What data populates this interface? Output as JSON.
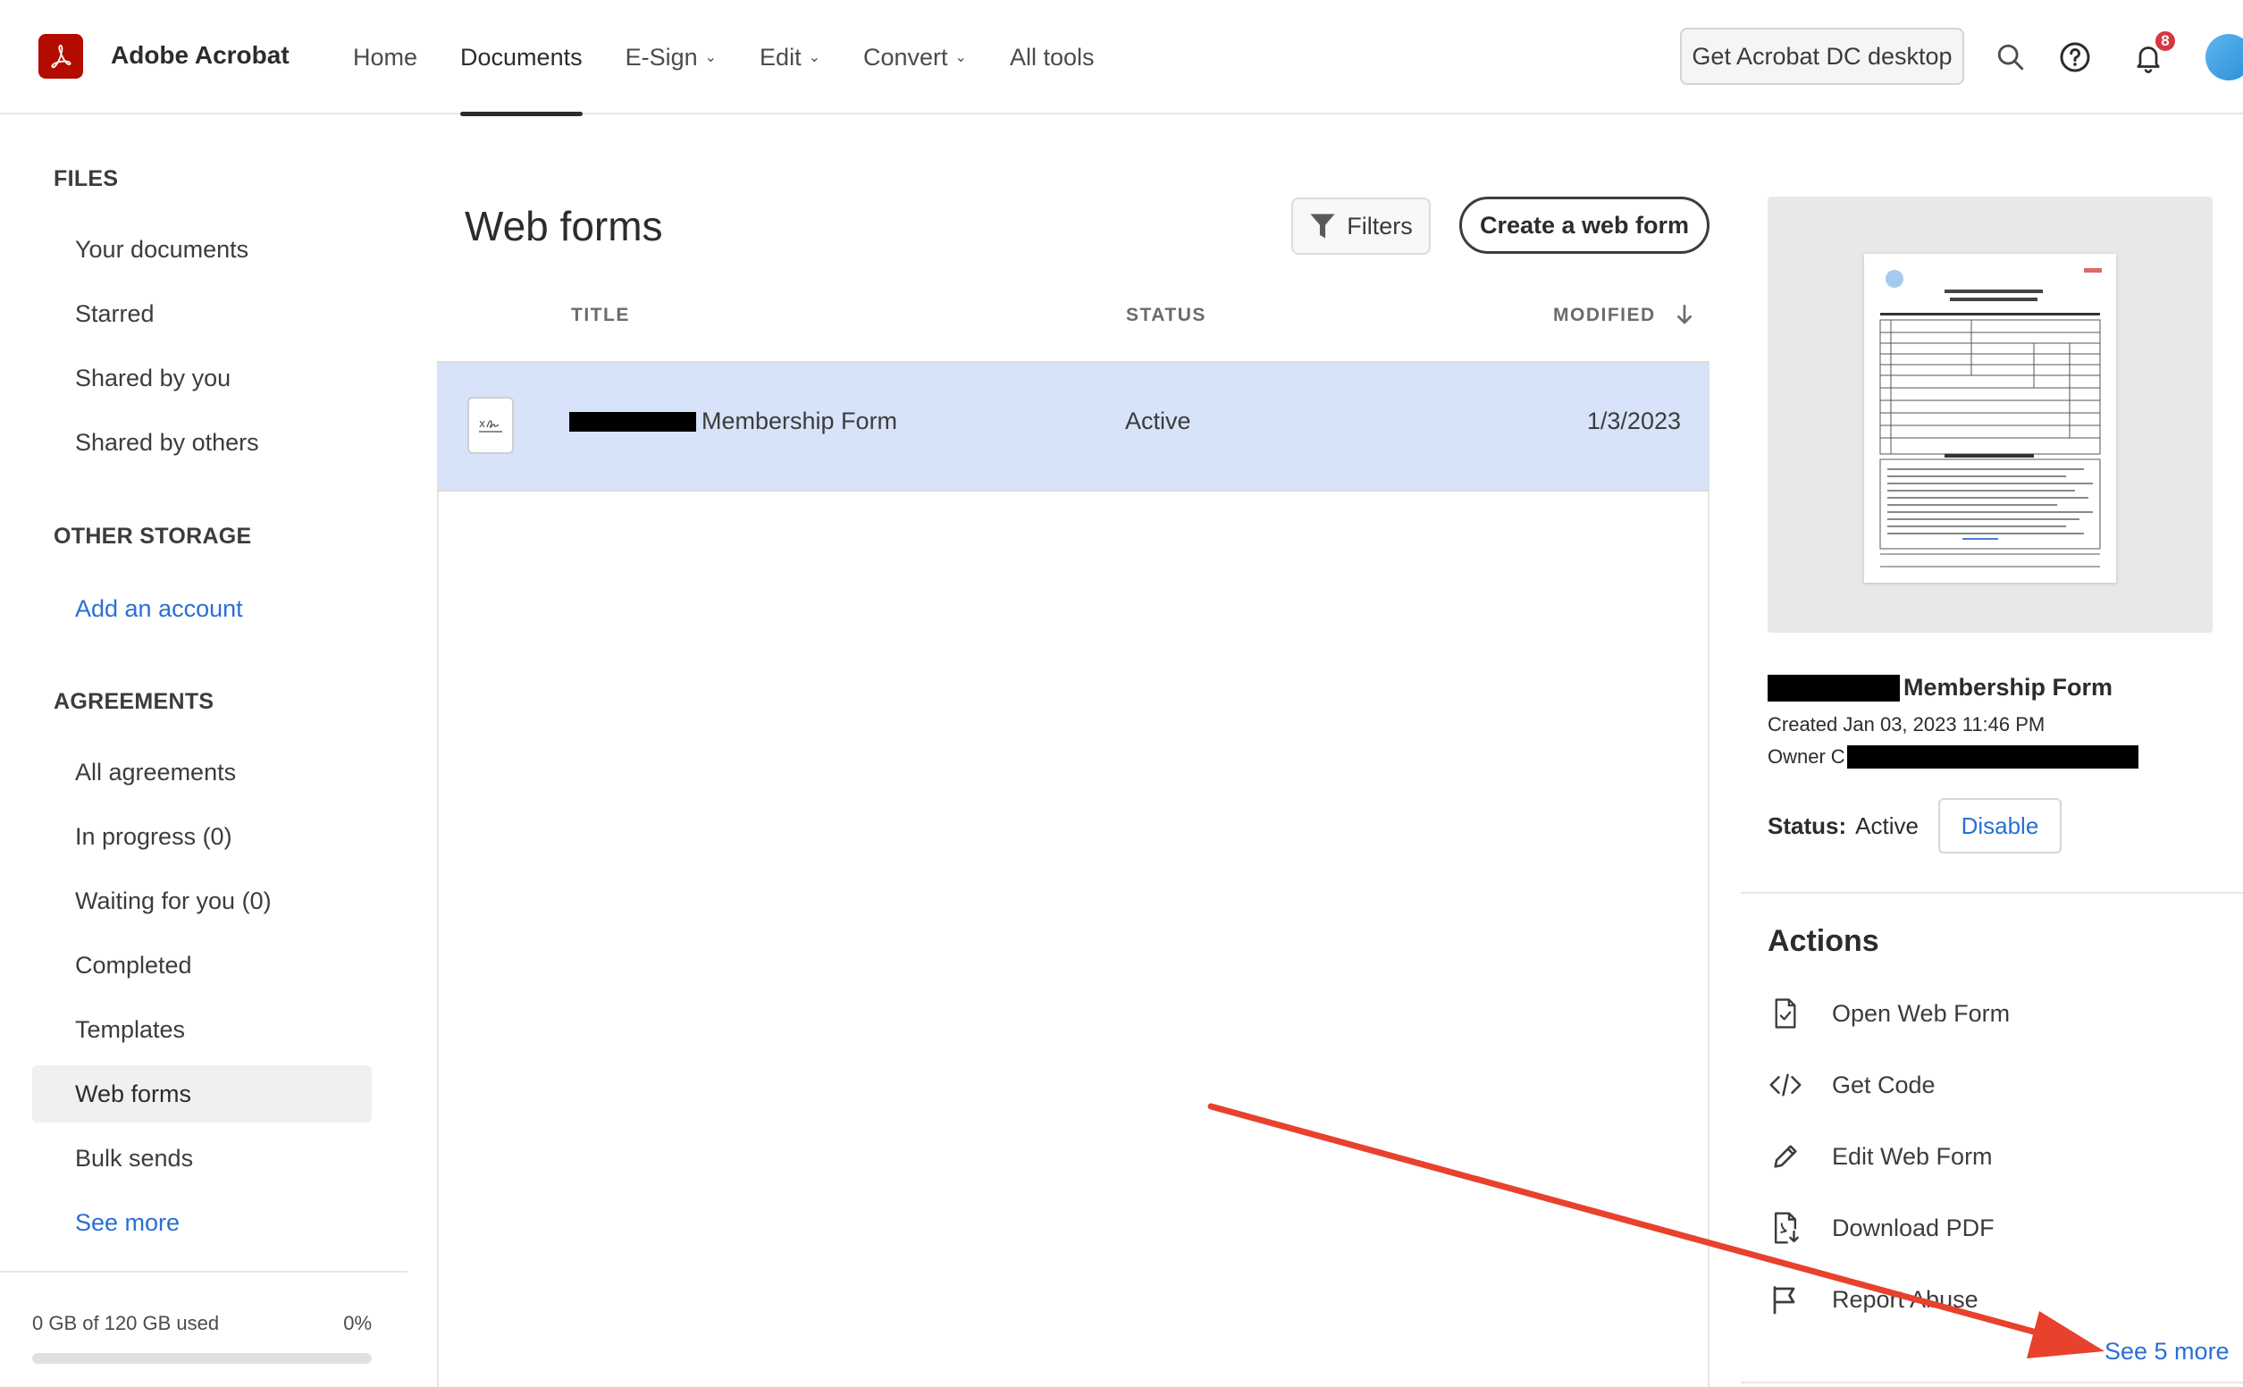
{
  "header": {
    "app_name": "Adobe Acrobat",
    "logo_icon": "acrobat-logo-icon",
    "nav": [
      {
        "label": "Home",
        "dropdown": false,
        "active": false
      },
      {
        "label": "Documents",
        "dropdown": false,
        "active": true
      },
      {
        "label": "E-Sign",
        "dropdown": true,
        "active": false
      },
      {
        "label": "Edit",
        "dropdown": true,
        "active": false
      },
      {
        "label": "Convert",
        "dropdown": true,
        "active": false
      },
      {
        "label": "All tools",
        "dropdown": false,
        "active": false
      }
    ],
    "desktop_button": "Get Acrobat DC desktop",
    "icons": [
      "search-icon",
      "help-icon",
      "notification-bell-icon",
      "avatar"
    ],
    "notification_count": "8"
  },
  "sidebar": {
    "files_title": "FILES",
    "files_items": [
      "Your documents",
      "Starred",
      "Shared by you",
      "Shared by others"
    ],
    "other_storage_title": "OTHER STORAGE",
    "add_account": "Add an account",
    "agreements_title": "AGREEMENTS",
    "agreements_items": [
      "All agreements",
      "In progress (0)",
      "Waiting for you (0)",
      "Completed",
      "Templates",
      "Web forms",
      "Bulk sends"
    ],
    "selected_item": "Web forms",
    "see_more": "See more",
    "storage": {
      "label": "0 GB of 120 GB used",
      "percent_label": "0%",
      "used_fraction": 0
    }
  },
  "main": {
    "title": "Web forms",
    "filters_label": "Filters",
    "create_label": "Create a web form",
    "columns": {
      "title": "TITLE",
      "status": "STATUS",
      "modified": "MODIFIED"
    },
    "sort_icon": "arrow-down-icon",
    "rows": [
      {
        "title_redacted": true,
        "title": "Membership Form",
        "status": "Active",
        "modified": "1/3/2023",
        "icon": "web-form-document-icon",
        "selected": true
      }
    ]
  },
  "details": {
    "title_redacted": true,
    "title": "Membership Form",
    "created": "Created Jan 03, 2023 11:46 PM",
    "owner_label": "Owner",
    "owner_redacted": true,
    "status_label": "Status:",
    "status_value": "Active",
    "disable_label": "Disable",
    "actions_title": "Actions",
    "actions": [
      {
        "label": "Open Web Form",
        "icon": "open-web-form-icon"
      },
      {
        "label": "Get Code",
        "icon": "code-icon"
      },
      {
        "label": "Edit Web Form",
        "icon": "pencil-icon"
      },
      {
        "label": "Download PDF",
        "icon": "download-pdf-icon"
      },
      {
        "label": "Report Abuse",
        "icon": "flag-icon"
      }
    ],
    "see_more": "See 5 more"
  },
  "annotation": {
    "type": "red-arrow",
    "color": "#e8412c",
    "points_to": "See 5 more"
  },
  "colors": {
    "brand_red": "#b30b00",
    "link_blue": "#2a6fd6",
    "selected_row_bg": "#d6e3f9",
    "badge_red": "#d7373f"
  }
}
